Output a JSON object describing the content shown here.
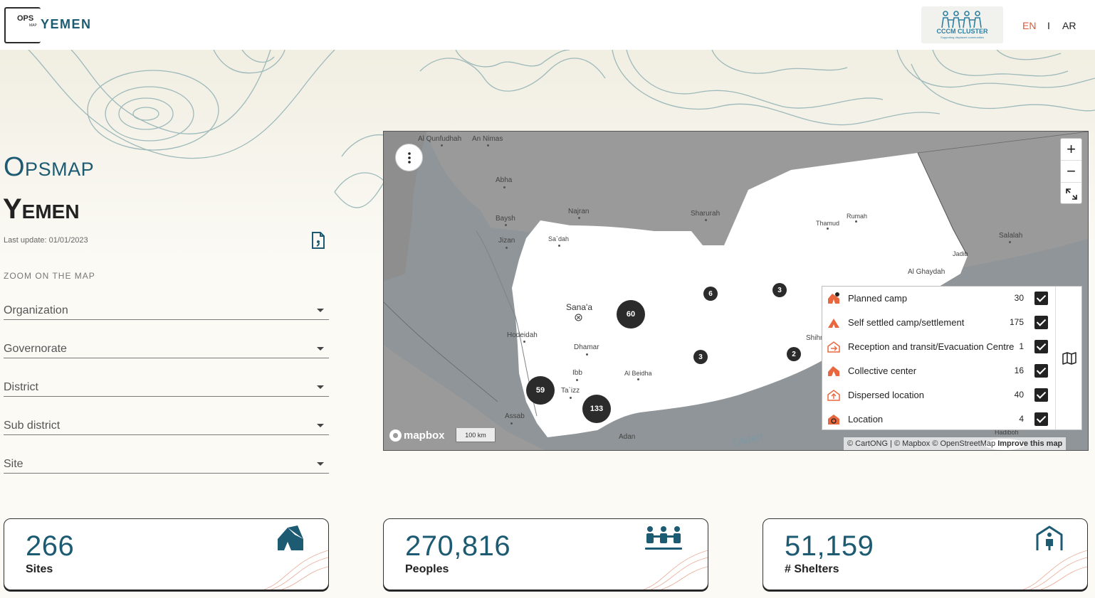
{
  "header": {
    "logo_ops": "OPS",
    "logo_map": "MAP",
    "logo_country": "YEMEN",
    "partner_logo": {
      "name": "CCCM CLUSTER",
      "tagline": "Supporting displaced communities"
    },
    "languages": {
      "en": "EN",
      "separator": "I",
      "ar": "AR"
    },
    "active_language": "EN"
  },
  "sidebar": {
    "title_ops": "Opsmap",
    "title_country": "Yemen",
    "last_update": "Last update: 01/01/2023",
    "zoom_label": "ZOOM ON THE MAP",
    "filters": [
      {
        "label": "Organization"
      },
      {
        "label": "Governorate"
      },
      {
        "label": "District"
      },
      {
        "label": "Sub district"
      },
      {
        "label": "Site"
      }
    ]
  },
  "map": {
    "labels": {
      "al_qunfudhah": "Al Qunfudhah",
      "an_nimas": "An Nimas",
      "abha": "Abha",
      "najran": "Najran",
      "sharurah": "Sharurah",
      "thamud": "Thamud",
      "rumah": "Rumah",
      "baysh": "Baysh",
      "jizan": "Jizan",
      "sadah": "Sa`dah",
      "salalah": "Salalah",
      "jadib": "Jadib",
      "al_ghaydah": "Al Ghaydah",
      "sanaa": "Sana'a",
      "hodeidah": "Hodeidah",
      "dhamar": "Dhamar",
      "shihr": "Shihr",
      "ibb": "Ibb",
      "al_beidha": "Al Beidha",
      "taizz": "Ta`izz",
      "assab": "Assab",
      "adan": "Adan",
      "hadiboh": "Hadiboh",
      "gulf_of_aden": "f Aden"
    },
    "clusters": [
      "60",
      "6",
      "3",
      "3",
      "2",
      "59",
      "133"
    ],
    "zoom_in": "+",
    "zoom_out": "−",
    "mapbox_label": "mapbox",
    "scale_label": "100 km",
    "attribution": "© CartONG | © Mapbox © OpenStreetMap",
    "improve_label": "Improve this map"
  },
  "legend": {
    "items": [
      {
        "name": "Planned camp",
        "count": "30",
        "checked": true,
        "icon": "planned-camp-icon"
      },
      {
        "name": "Self settled camp/settlement",
        "count": "175",
        "checked": true,
        "icon": "self-settled-camp-icon"
      },
      {
        "name": "Reception and transit/Evacuation Centre",
        "count": "1",
        "checked": true,
        "icon": "reception-transit-icon"
      },
      {
        "name": "Collective center",
        "count": "16",
        "checked": true,
        "icon": "collective-center-icon"
      },
      {
        "name": "Dispersed location",
        "count": "40",
        "checked": true,
        "icon": "dispersed-location-icon"
      },
      {
        "name": "Location",
        "count": "4",
        "checked": true,
        "icon": "location-icon"
      }
    ]
  },
  "stats": [
    {
      "value": "266",
      "label": "Sites",
      "icon": "tent-icon"
    },
    {
      "value": "270,816",
      "label": "Peoples",
      "icon": "people-group-icon"
    },
    {
      "value": "51,159",
      "label": "# Shelters",
      "icon": "shelter-person-icon"
    }
  ],
  "colors": {
    "brand": "#1d5b73",
    "accent": "#e0593b",
    "marker_orange": "#e8673e",
    "cluster": "#2b2b2b",
    "background": "#fbfaf5"
  }
}
